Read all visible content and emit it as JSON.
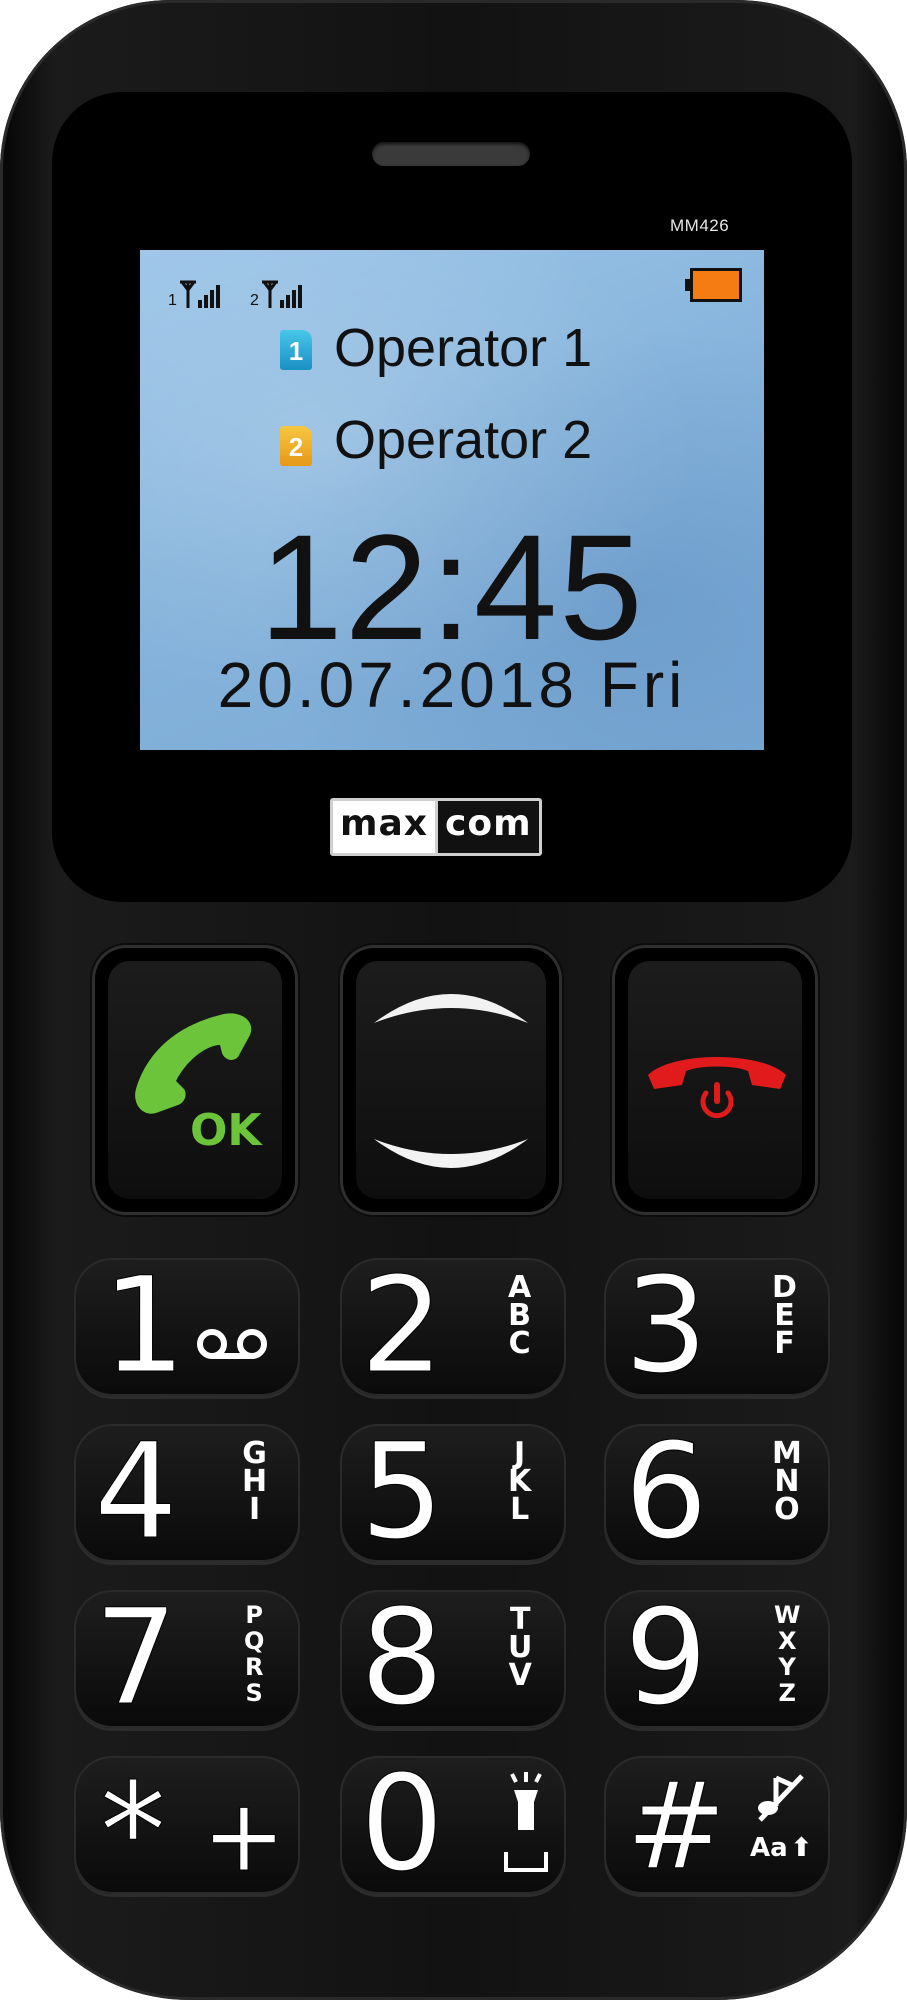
{
  "device": {
    "model": "MM426",
    "brand_left": "max",
    "brand_right": "com"
  },
  "status_bar": {
    "sim1_label": "1",
    "sim2_label": "2",
    "battery_color": "#f57c12"
  },
  "screen": {
    "operators": [
      {
        "sim": "1",
        "name": "Operator 1",
        "icon": "sim-1-icon",
        "color": "#1a8fc4"
      },
      {
        "sim": "2",
        "name": "Operator 2",
        "icon": "sim-2-icon",
        "color": "#e79817"
      }
    ],
    "time": "12:45",
    "date": "20.07.2018 Fri"
  },
  "soft_keys": {
    "call_label": "OK",
    "call_color": "#6cc43a",
    "end_color": "#e11b1b",
    "nav_up_icon": "nav-up-icon",
    "nav_down_icon": "nav-down-icon"
  },
  "keypad": {
    "keys": [
      {
        "digit": "1",
        "letters": []
      },
      {
        "digit": "2",
        "letters": [
          "A",
          "B",
          "C"
        ]
      },
      {
        "digit": "3",
        "letters": [
          "D",
          "E",
          "F"
        ]
      },
      {
        "digit": "4",
        "letters": [
          "G",
          "H",
          "I"
        ]
      },
      {
        "digit": "5",
        "letters": [
          "J",
          "K",
          "L"
        ]
      },
      {
        "digit": "6",
        "letters": [
          "M",
          "N",
          "O"
        ]
      },
      {
        "digit": "7",
        "letters": [
          "P",
          "Q",
          "R",
          "S"
        ]
      },
      {
        "digit": "8",
        "letters": [
          "T",
          "U",
          "V"
        ]
      },
      {
        "digit": "9",
        "letters": [
          "W",
          "X",
          "Y",
          "Z"
        ]
      },
      {
        "digit": "*",
        "letters": []
      },
      {
        "digit": "0",
        "letters": []
      },
      {
        "digit": "#",
        "letters": []
      }
    ],
    "star_extra": "+",
    "hash_extra": "Aa"
  }
}
